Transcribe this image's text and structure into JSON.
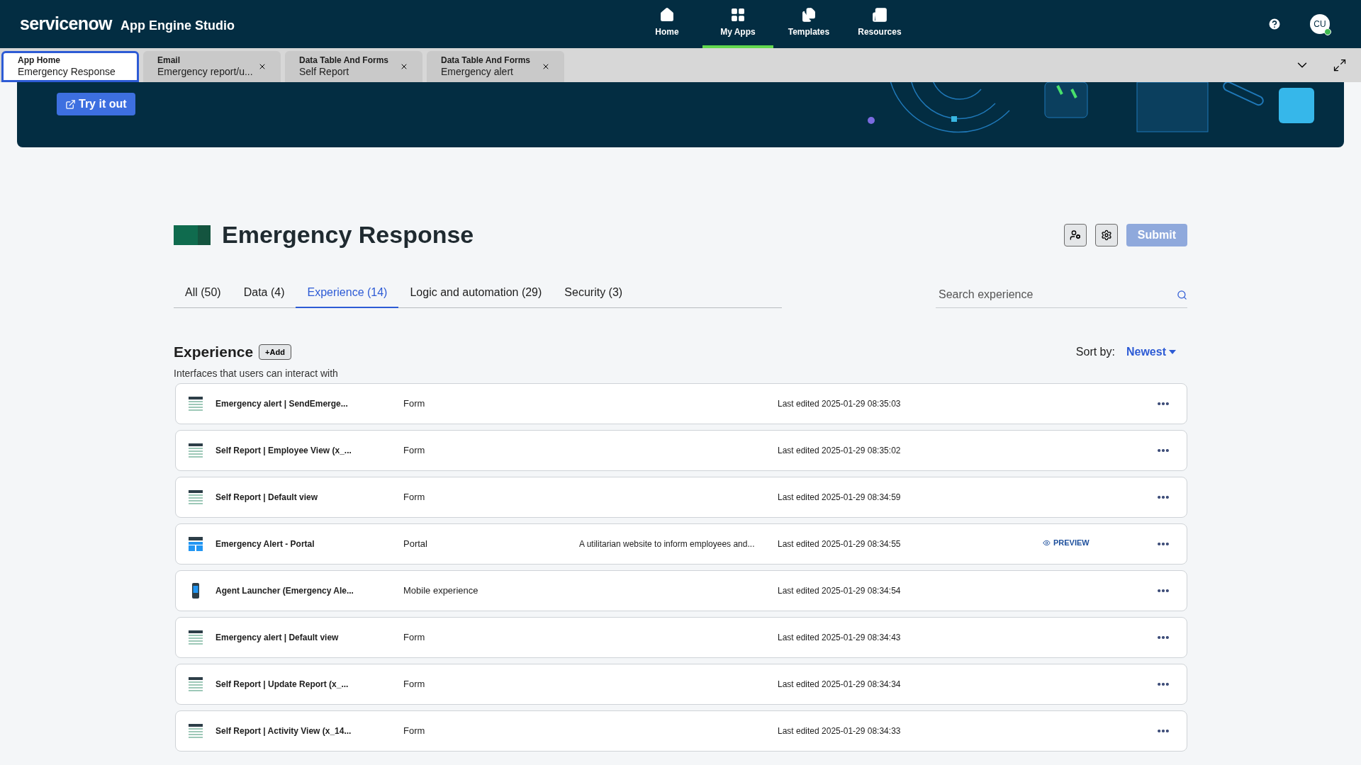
{
  "header": {
    "brand": "servicenow",
    "product": "App Engine Studio",
    "nav": [
      {
        "label": "Home",
        "selected": false
      },
      {
        "label": "My Apps",
        "selected": true
      },
      {
        "label": "Templates",
        "selected": false
      },
      {
        "label": "Resources",
        "selected": false
      }
    ],
    "avatar": "CU"
  },
  "app_tabs": [
    {
      "title": "App Home",
      "subtitle": "Emergency Response",
      "selected": true,
      "closable": false
    },
    {
      "title": "Email",
      "subtitle": "Emergency report/u...",
      "selected": false,
      "closable": true
    },
    {
      "title": "Data Table And Forms",
      "subtitle": "Self Report",
      "selected": false,
      "closable": true
    },
    {
      "title": "Data Table And Forms",
      "subtitle": "Emergency alert",
      "selected": false,
      "closable": true
    }
  ],
  "banner": {
    "button": "Try it out"
  },
  "app": {
    "title": "Emergency Response",
    "submit": {
      "label": "Submit",
      "disabled": true
    }
  },
  "filter_tabs": [
    {
      "label": "All (50)",
      "selected": false
    },
    {
      "label": "Data (4)",
      "selected": false
    },
    {
      "label": "Experience (14)",
      "selected": true
    },
    {
      "label": "Logic and automation (29)",
      "selected": false
    },
    {
      "label": "Security (3)",
      "selected": false
    }
  ],
  "search": {
    "placeholder": "Search experience"
  },
  "section": {
    "title": "Experience",
    "add": "+Add",
    "description": "Interfaces that users can interact with",
    "sort_label": "Sort by:",
    "sort_value": "Newest"
  },
  "rows": [
    {
      "kind": "form",
      "name": "Emergency alert | SendEmerge...",
      "type": "Form",
      "edited": "Last edited 2025-01-29 08:35:03"
    },
    {
      "kind": "form",
      "name": "Self Report | Employee View (x_...",
      "type": "Form",
      "edited": "Last edited 2025-01-29 08:35:02"
    },
    {
      "kind": "form",
      "name": "Self Report | Default view",
      "type": "Form",
      "edited": "Last edited 2025-01-29 08:34:59"
    },
    {
      "kind": "portal",
      "name": "Emergency Alert - Portal",
      "type": "Portal",
      "description": "A utilitarian website to inform employees and...",
      "edited": "Last edited 2025-01-29 08:34:55",
      "preview": "PREVIEW"
    },
    {
      "kind": "mobile",
      "name": "Agent Launcher (Emergency Ale...",
      "type": "Mobile experience",
      "edited": "Last edited 2025-01-29 08:34:54"
    },
    {
      "kind": "form",
      "name": "Emergency alert | Default view",
      "type": "Form",
      "edited": "Last edited 2025-01-29 08:34:43"
    },
    {
      "kind": "form",
      "name": "Self Report | Update Report (x_...",
      "type": "Form",
      "edited": "Last edited 2025-01-29 08:34:34"
    },
    {
      "kind": "form",
      "name": "Self Report | Activity View (x_14...",
      "type": "Form",
      "edited": "Last edited 2025-01-29 08:34:33"
    }
  ]
}
